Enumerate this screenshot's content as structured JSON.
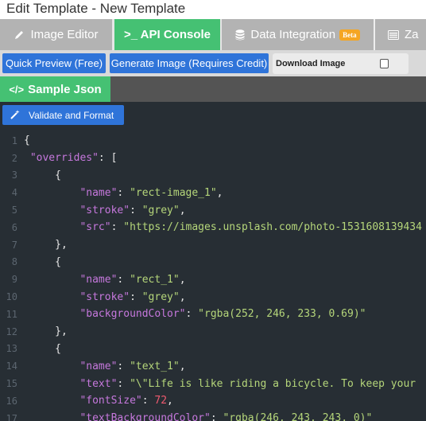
{
  "window": {
    "title": "Edit Template - New Template"
  },
  "tabs": [
    {
      "label": "Image Editor",
      "icon": "pencil-icon",
      "active": false
    },
    {
      "label": ">_ API Console",
      "icon": "terminal-icon",
      "active": true
    },
    {
      "label": "Data Integration",
      "icon": "database-icon",
      "badge": "Beta",
      "active": false
    },
    {
      "label": "Za",
      "icon": "table-icon",
      "active": false
    }
  ],
  "toolbar": {
    "quick_preview": "Quick Preview (Free)",
    "generate_image": "Generate Image (Requires Credit)",
    "download_image": "Download Image",
    "download_checked": false
  },
  "sample_tab": {
    "label": "Sample Json",
    "icon": "code-icon"
  },
  "validate_button": {
    "label": "Validate and Format",
    "icon": "magic-wand-icon"
  },
  "colors": {
    "accent_green": "#45c173",
    "button_blue": "#2f74d9",
    "beta_orange": "#f5a623",
    "editor_bg": "#272e34"
  },
  "code": {
    "lines": [
      {
        "n": "1",
        "indent": 0,
        "tokens": [
          [
            "p",
            "{"
          ]
        ]
      },
      {
        "n": "2",
        "indent": 1,
        "tokens": [
          [
            "k",
            "\"overrides\""
          ],
          [
            "p",
            ": ["
          ]
        ]
      },
      {
        "n": "3",
        "indent": 5,
        "tokens": [
          [
            "p",
            "{"
          ]
        ]
      },
      {
        "n": "4",
        "indent": 9,
        "tokens": [
          [
            "k",
            "\"name\""
          ],
          [
            "p",
            ": "
          ],
          [
            "s",
            "\"rect-image_1\""
          ],
          [
            "p",
            ","
          ]
        ]
      },
      {
        "n": "5",
        "indent": 9,
        "tokens": [
          [
            "k",
            "\"stroke\""
          ],
          [
            "p",
            ": "
          ],
          [
            "s",
            "\"grey\""
          ],
          [
            "p",
            ","
          ]
        ]
      },
      {
        "n": "6",
        "indent": 9,
        "tokens": [
          [
            "k",
            "\"src\""
          ],
          [
            "p",
            ": "
          ],
          [
            "s",
            "\"https://images.unsplash.com/photo-1531608139434"
          ]
        ]
      },
      {
        "n": "7",
        "indent": 5,
        "tokens": [
          [
            "p",
            "},"
          ]
        ]
      },
      {
        "n": "8",
        "indent": 5,
        "tokens": [
          [
            "p",
            "{"
          ]
        ]
      },
      {
        "n": "9",
        "indent": 9,
        "tokens": [
          [
            "k",
            "\"name\""
          ],
          [
            "p",
            ": "
          ],
          [
            "s",
            "\"rect_1\""
          ],
          [
            "p",
            ","
          ]
        ]
      },
      {
        "n": "10",
        "indent": 9,
        "tokens": [
          [
            "k",
            "\"stroke\""
          ],
          [
            "p",
            ": "
          ],
          [
            "s",
            "\"grey\""
          ],
          [
            "p",
            ","
          ]
        ]
      },
      {
        "n": "11",
        "indent": 9,
        "tokens": [
          [
            "k",
            "\"backgroundColor\""
          ],
          [
            "p",
            ": "
          ],
          [
            "s",
            "\"rgba(252, 246, 233, 0.69)\""
          ]
        ]
      },
      {
        "n": "12",
        "indent": 5,
        "tokens": [
          [
            "p",
            "},"
          ]
        ]
      },
      {
        "n": "13",
        "indent": 5,
        "tokens": [
          [
            "p",
            "{"
          ]
        ]
      },
      {
        "n": "14",
        "indent": 9,
        "tokens": [
          [
            "k",
            "\"name\""
          ],
          [
            "p",
            ": "
          ],
          [
            "s",
            "\"text_1\""
          ],
          [
            "p",
            ","
          ]
        ]
      },
      {
        "n": "15",
        "indent": 9,
        "tokens": [
          [
            "k",
            "\"text\""
          ],
          [
            "p",
            ": "
          ],
          [
            "s",
            "\"\\\"Life is like riding a bicycle. To keep your"
          ]
        ]
      },
      {
        "n": "16",
        "indent": 9,
        "tokens": [
          [
            "k",
            "\"fontSize\""
          ],
          [
            "p",
            ": "
          ],
          [
            "n",
            "72"
          ],
          [
            "p",
            ","
          ]
        ]
      },
      {
        "n": "17",
        "indent": 9,
        "tokens": [
          [
            "k",
            "\"textBackgroundColor\""
          ],
          [
            "p",
            ": "
          ],
          [
            "s",
            "\"rgba(246, 243, 243, 0)\""
          ]
        ]
      }
    ]
  }
}
